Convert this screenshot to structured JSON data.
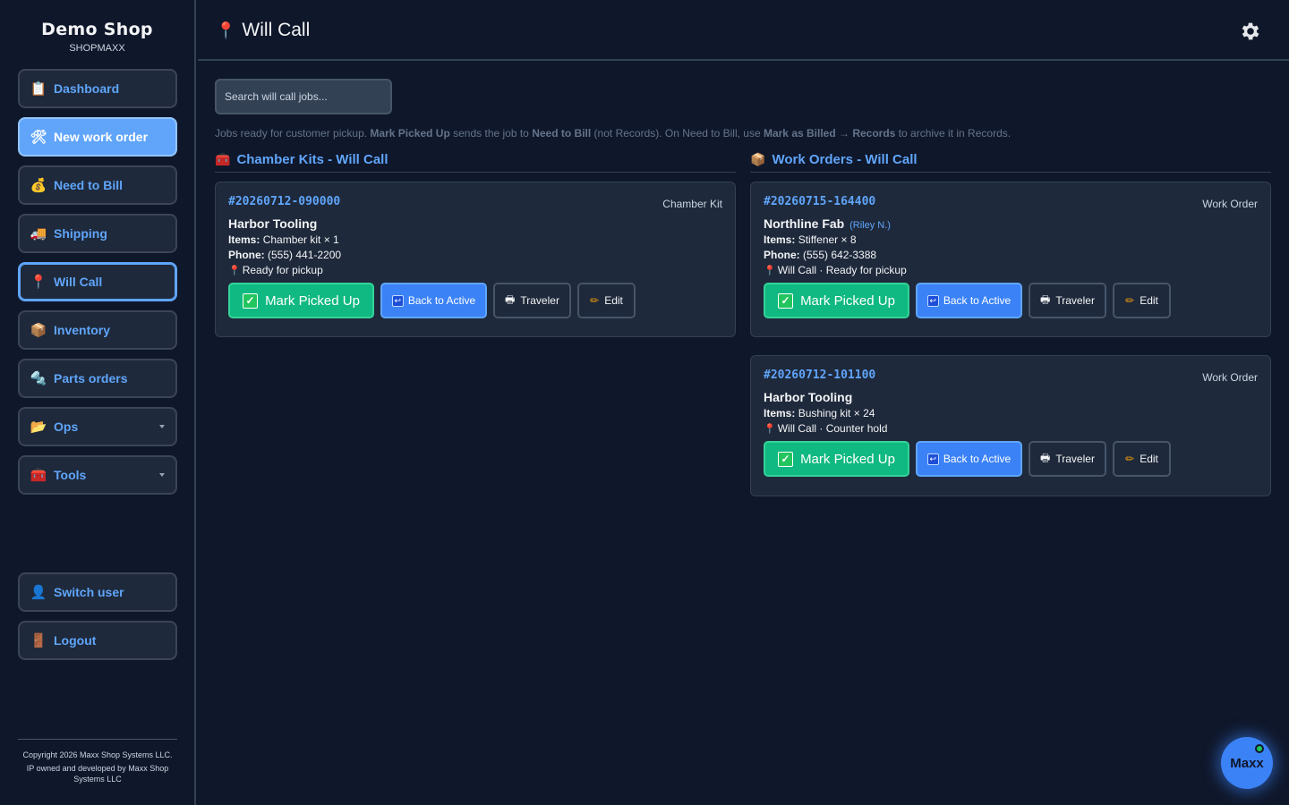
{
  "brand": {
    "name": "Demo Shop",
    "subtitle": "SHOPMAXX"
  },
  "sidebar": {
    "items": [
      {
        "label": "Dashboard",
        "icon": "clipboard-icon"
      },
      {
        "label": "New work order",
        "icon": "tools-icon"
      },
      {
        "label": "Need to Bill",
        "icon": "money-bag-icon"
      },
      {
        "label": "Shipping",
        "icon": "truck-icon"
      },
      {
        "label": "Will Call",
        "icon": "pin-icon"
      },
      {
        "label": "Inventory",
        "icon": "box-icon"
      },
      {
        "label": "Parts orders",
        "icon": "bolt-nut-icon"
      },
      {
        "label": "Ops",
        "icon": "folder-icon"
      },
      {
        "label": "Tools",
        "icon": "toolbox-icon"
      }
    ],
    "bottom": [
      {
        "label": "Switch user",
        "icon": "user-icon"
      },
      {
        "label": "Logout",
        "icon": "door-icon"
      }
    ],
    "copyright_line1": "Copyright 2026 Maxx Shop Systems LLC.",
    "copyright_line2": "IP owned and developed by Maxx Shop Systems LLC"
  },
  "header": {
    "title": "Will Call"
  },
  "search": {
    "placeholder": "Search will call jobs..."
  },
  "info": {
    "p1": "Jobs ready for customer pickup. ",
    "b1": "Mark Picked Up",
    "p2": " sends the job to ",
    "b2": "Need to Bill",
    "p3": " (not Records). On Need to Bill, use ",
    "b3": "Mark as Billed → Records",
    "p4": " to archive it in Records."
  },
  "sections": {
    "chamber": {
      "title": "Chamber Kits - Will Call"
    },
    "work": {
      "title": "Work Orders - Will Call"
    }
  },
  "labels": {
    "items": "Items:",
    "phone": "Phone:",
    "mark_picked_up": "Mark Picked Up",
    "back_to_active": "Back to Active",
    "traveler": "Traveler",
    "edit": "Edit"
  },
  "cards": [
    {
      "number": "#20260712-090000",
      "type": "Chamber Kit",
      "name": "Harbor Tooling",
      "contact": "",
      "items": "Chamber kit × 1",
      "phone": "(555) 441-2200",
      "status": "Ready for pickup"
    },
    {
      "number": "#20260715-164400",
      "type": "Work Order",
      "name": "Northline Fab",
      "contact": "(Riley N.)",
      "items": "Stiffener × 8",
      "phone": "(555) 642-3388",
      "status": "Will Call · Ready for pickup"
    },
    {
      "number": "#20260712-101100",
      "type": "Work Order",
      "name": "Harbor Tooling",
      "contact": "",
      "items": "Bushing kit × 24",
      "status": "Will Call · Counter hold"
    }
  ],
  "assistant": {
    "label": "Maxx",
    "status_color": "#22c55e"
  },
  "colors": {
    "accent": "#60a5fa",
    "success": "#10b981",
    "primary": "#3b82f6",
    "background": "#0f172a"
  }
}
